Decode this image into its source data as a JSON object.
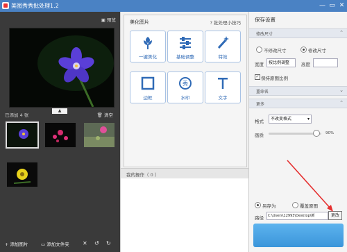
{
  "app": {
    "title": "美图秀秀批处理1.2"
  },
  "left": {
    "preview_label": "预览",
    "added_label": "已添加 4 张",
    "clear_label": "清空",
    "bottom": {
      "add_image": "添加图片",
      "add_folder": "添加文件夹"
    }
  },
  "middle": {
    "header": "美化图片",
    "tip": "批处理小技巧",
    "tools": [
      "一键美化",
      "基础调整",
      "特效",
      "边框",
      "水印",
      "文字"
    ],
    "ops": "我的操作（ 0 ）"
  },
  "right": {
    "title": "保存设置",
    "size_section": "修改尺寸",
    "keep_size": "不修改尺寸",
    "change_size": "修改尺寸",
    "width_label": "宽度",
    "width_value": "按比例调整",
    "height_label": "高度",
    "keep_ratio": "保持原图比例",
    "rename_section": "重命名",
    "more_section": "更多",
    "format_label": "格式",
    "format_value": "不改变格式",
    "quality_label": "画质",
    "quality_value": "90%",
    "save_as": "另存为",
    "overwrite": "覆盖原图",
    "path_label": "路径",
    "path_value": "C:\\Users\\12993\\Desktop\\新",
    "browse": "更改"
  },
  "colors": {
    "titlebar": "#4a82c4",
    "tool_label": "#2f6ab6",
    "save_button": "#3a95da",
    "annotation_arrow": "#e53030"
  }
}
